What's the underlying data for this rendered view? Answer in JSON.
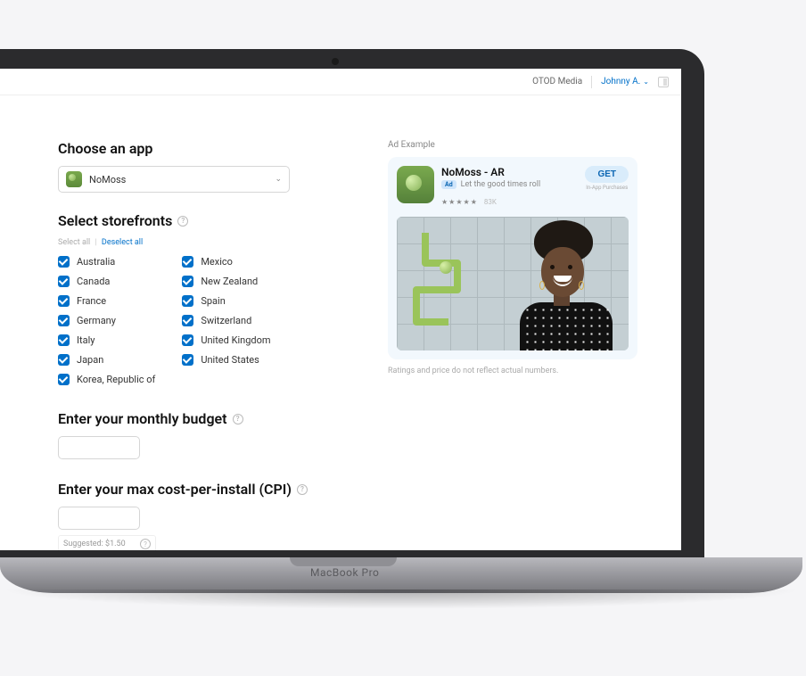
{
  "header": {
    "org": "OTOD Media",
    "user": "Johnny A."
  },
  "choose_app": {
    "heading": "Choose an app",
    "selected": "NoMoss"
  },
  "storefronts": {
    "heading": "Select storefronts",
    "select_all": "Select all",
    "deselect_all": "Deselect all",
    "col1": [
      "Australia",
      "Canada",
      "France",
      "Germany",
      "Italy",
      "Japan",
      "Korea, Republic of"
    ],
    "col2": [
      "Mexico",
      "New Zealand",
      "Spain",
      "Switzerland",
      "United Kingdom",
      "United States"
    ]
  },
  "budget": {
    "heading": "Enter your monthly budget",
    "value": ""
  },
  "cpi": {
    "heading": "Enter your max cost-per-install (CPI)",
    "value": "",
    "suggested_label": "Suggested: $1.50"
  },
  "preview": {
    "label": "Ad Example",
    "title": "NoMoss - AR",
    "badge": "Ad",
    "tagline": "Let the good times roll",
    "rating_count": "83K",
    "get": "GET",
    "iap": "In-App Purchases",
    "disclaimer": "Ratings and price do not reflect actual numbers."
  },
  "device_label": "MacBook Pro"
}
